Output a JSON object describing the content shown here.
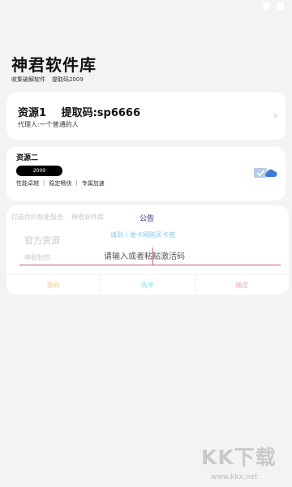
{
  "header": {
    "title": "神君软件库",
    "subtitle_items": [
      "收集破解软件",
      "提取码2009"
    ]
  },
  "resource1": {
    "title": "资源1",
    "code": "提取码:sp6666",
    "agent": "代理人:一个普通的人",
    "chevron_icon": "chevron-right-icon"
  },
  "resource2": {
    "title": "资源二",
    "badge": "2009",
    "features": [
      "性能卓越",
      "稳定畅快",
      "专属加速"
    ],
    "icon": "cloud-check-icon"
  },
  "dialog": {
    "background_row": [
      "打造你的智能服务",
      "神君软件库"
    ],
    "notice_title": "公告",
    "official": "官方资源",
    "notice_text": "请到丨发卡网购买卡密",
    "shenjun_text": "神君制作",
    "input_placeholder": "请输入或者粘贴激活码",
    "buttons": {
      "query": "查码",
      "buy": "购卡",
      "confirm": "确定"
    }
  },
  "watermark": {
    "logo": "KK下载",
    "url": "www.kkx.net"
  },
  "colors": {
    "background": "#f3f3f3",
    "notice_title": "#7b6aa8",
    "underline": "#c5558a",
    "query": "#f3c98b",
    "buy": "#8fd9e8",
    "confirm": "#f0a8c4"
  }
}
